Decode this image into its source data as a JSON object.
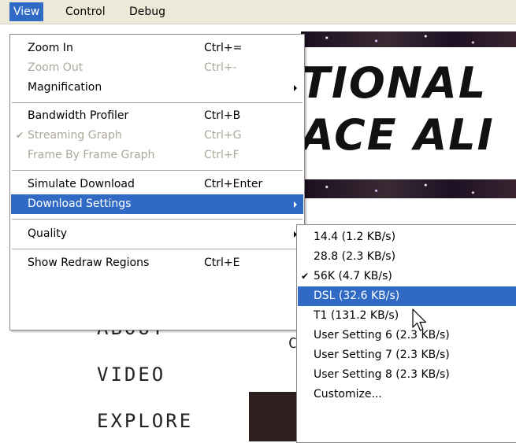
{
  "menubar": {
    "items": [
      {
        "label": "View",
        "active": true
      },
      {
        "label": "Control",
        "active": false
      },
      {
        "label": "Debug",
        "active": false
      }
    ]
  },
  "view_menu": {
    "items": [
      {
        "label": "Zoom In",
        "shortcut": "Ctrl+=",
        "disabled": false
      },
      {
        "label": "Zoom Out",
        "shortcut": "Ctrl+-",
        "disabled": true
      },
      {
        "label": "Magnification",
        "shortcut": "",
        "submenu": true
      },
      {
        "label": "Bandwidth Profiler",
        "shortcut": "Ctrl+B",
        "disabled": false
      },
      {
        "label": "Streaming Graph",
        "shortcut": "Ctrl+G",
        "disabled": true,
        "checked": true
      },
      {
        "label": "Frame By Frame Graph",
        "shortcut": "Ctrl+F",
        "disabled": true
      },
      {
        "label": "Simulate Download",
        "shortcut": "Ctrl+Enter",
        "disabled": false
      },
      {
        "label": "Download Settings",
        "shortcut": "",
        "submenu": true,
        "highlighted": true
      },
      {
        "label": "Quality",
        "shortcut": "",
        "submenu": true
      },
      {
        "label": "Show Redraw Regions",
        "shortcut": "Ctrl+E",
        "disabled": false
      }
    ]
  },
  "download_settings_menu": {
    "items": [
      {
        "label": "14.4 (1.2 KB/s)"
      },
      {
        "label": "28.8 (2.3 KB/s)"
      },
      {
        "label": "56K (4.7 KB/s)",
        "checked": true
      },
      {
        "label": "DSL (32.6 KB/s)",
        "highlighted": true
      },
      {
        "label": "T1 (131.2 KB/s)"
      },
      {
        "label": "User Setting 6 (2.3 KB/s)"
      },
      {
        "label": "User Setting 7 (2.3 KB/s)"
      },
      {
        "label": "User Setting 8 (2.3 KB/s)"
      },
      {
        "label": "Customize..."
      }
    ]
  },
  "page": {
    "banner_line1": "TIONAL",
    "banner_line2": "ACE ALI",
    "nav": [
      "ABOUT",
      "VIDEO",
      "EXPLORE"
    ],
    "partial_letter": "C"
  },
  "glyphs": {
    "check": "✔"
  },
  "colors": {
    "highlight": "#316ac5",
    "menubar": "#ece9d8",
    "disabled_text": "#aca899"
  }
}
